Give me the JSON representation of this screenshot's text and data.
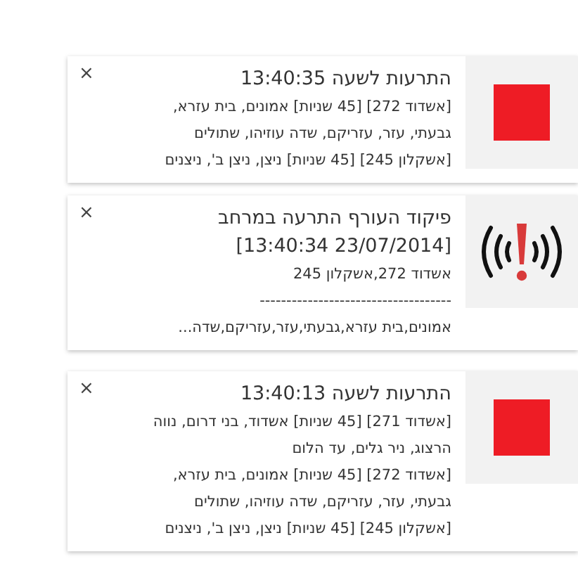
{
  "notifications": [
    {
      "kind": "square",
      "close": "×",
      "title_lines": [
        "התרעות לשעה 13:40:35"
      ],
      "body_lines": [
        "[אשדוד 272] [45 שניות] אמונים, בית עזרא,",
        "גבעתי, עזר, עזריקם, שדה עוזיהו, שתולים",
        "[אשקלון 245] [45 שניות] ניצן, ניצן ב', ניצנים"
      ]
    },
    {
      "kind": "alert",
      "close": "×",
      "title_lines": [
        "פיקוד העורף התרעה במרחב",
        "[13:40:34 23/07/2014]"
      ],
      "body_lines": [
        "אשדוד 272,אשקלון 245",
        "------------------------------------",
        "אמונים,בית עזרא,גבעתי,עזר,עזריקם,שדה..."
      ]
    },
    {
      "kind": "square",
      "close": "×",
      "title_lines": [
        "התרעות לשעה 13:40:13"
      ],
      "body_lines": [
        "[אשדוד 271] [45 שניות] אשדוד, בני דרום, נווה",
        "הרצוג, ניר גלים, עד הלום",
        "[אשדוד 272] [45 שניות] אמונים, בית עזרא,",
        "גבעתי, עזר, עזריקם, שדה עוזיהו, שתולים",
        "[אשקלון 245] [45 שניות] ניצן, ניצן ב', ניצנים"
      ]
    }
  ]
}
